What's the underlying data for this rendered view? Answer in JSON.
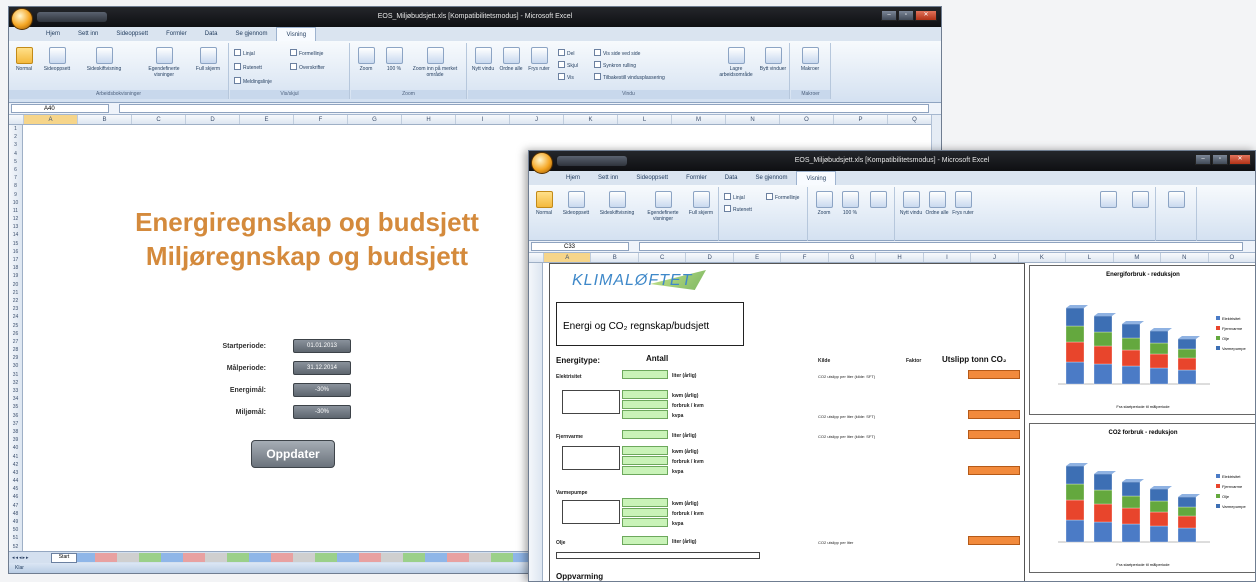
{
  "window1": {
    "title": "EOS_Miljøbudsjett.xls [Kompatibilitetsmodus] - Microsoft Excel",
    "tabs": [
      "Hjem",
      "Sett inn",
      "Sideoppsett",
      "Formler",
      "Data",
      "Se gjennom",
      "Visning"
    ],
    "ribbon": {
      "views_label": "Arbeidsbokvisninger",
      "views": [
        "Normal",
        "Sideoppsett",
        "Sideskiftvisning",
        "Egendefinerte visninger",
        "Full skjerm"
      ],
      "show_label": "Vis/skjul",
      "show_checks": [
        "Linjal",
        "Rutenett",
        "Meldingslinje",
        "Formellinje",
        "Overskrifter"
      ],
      "zoom_label": "Zoom",
      "zoom_buttons": [
        "Zoom",
        "100 %",
        "Zoom inn på merket område"
      ],
      "window_label": "Vindu",
      "window_buttons": [
        "Nytt vindu",
        "Ordne alle",
        "Frys ruter",
        "Del",
        "Skjul",
        "Vis"
      ],
      "window_small": [
        "Vis side ved side",
        "Synkron rulling",
        "Tilbakestill vindusplassering"
      ],
      "window_big": [
        "Lagre arbeidsområde",
        "Bytt vinduer"
      ],
      "macro_label": "Makroer",
      "macro_button": "Makroer"
    },
    "namebox": "A40",
    "columns": [
      "A",
      "B",
      "C",
      "D",
      "E",
      "F",
      "G",
      "H",
      "I",
      "J",
      "K",
      "L",
      "M",
      "N",
      "O",
      "P",
      "Q"
    ],
    "title_line1": "Energiregnskap og budsjett",
    "title_line2": "Miljøregnskap og budsjett",
    "fields": [
      {
        "label": "Startperiode:",
        "value": "01.01.2013"
      },
      {
        "label": "Målperiode:",
        "value": "31.12.2014"
      },
      {
        "label": "Energimål:",
        "value": "-30%"
      },
      {
        "label": "Miljømål:",
        "value": "-30%"
      }
    ],
    "update_button": "Oppdater",
    "first_sheet": "Start",
    "status": "Klar"
  },
  "window2": {
    "title": "EOS_Miljøbudsjett.xls [Kompatibilitetsmodus] - Microsoft Excel",
    "tabs": [
      "Hjem",
      "Sett inn",
      "Sideoppsett",
      "Formler",
      "Data",
      "Se gjennom",
      "Visning"
    ],
    "namebox": "C33",
    "logo": "KLIMALØFTET",
    "title_box": "Energi og CO₂ regnskap/budsjett",
    "hdr_type": "Energitype:",
    "hdr_count": "Antall",
    "hdr_source": "Kilde",
    "hdr_factor": "Faktor",
    "hdr_emission": "Utslipp tonn CO₂",
    "rows": [
      {
        "name": "Elektrisitet",
        "units": [
          "liter (årlig)"
        ],
        "source": "CO2 utslipp per liter (kilde: SFT)"
      },
      {
        "name": "",
        "units": [
          "kwm (årlig)",
          "forbruk / kvm",
          "kvpa"
        ],
        "source": "CO2 utslipp per liter (kilde: SFT)"
      },
      {
        "name": "Fjernvarme",
        "units": [
          "liter (årlig)",
          "kwm (årlig)",
          "forbruk / kvm",
          "kvpa"
        ],
        "source": "CO2 utslipp per liter (kilde: SFT)"
      },
      {
        "name": "Varmepumpe",
        "units": [
          "kwm (årlig)",
          "forbruk / kvm",
          "kvpa"
        ],
        "source": ""
      },
      {
        "name": "Olje",
        "units": [
          "liter (årlig)"
        ],
        "source": "CO2 utslipp per liter"
      }
    ],
    "oppvarming": "Oppvarming",
    "chart1_title": "Energiforbruk - reduksjon",
    "chart1_xlabel": "Fra startperiode til målperiode",
    "chart2_title": "CO2 forbruk - reduksjon",
    "chart2_xlabel": "Fra startperiode til målperiode",
    "legend": [
      "Elektrisitet",
      "Fjernvarme",
      "Olje",
      "Varmepumpe"
    ]
  }
}
